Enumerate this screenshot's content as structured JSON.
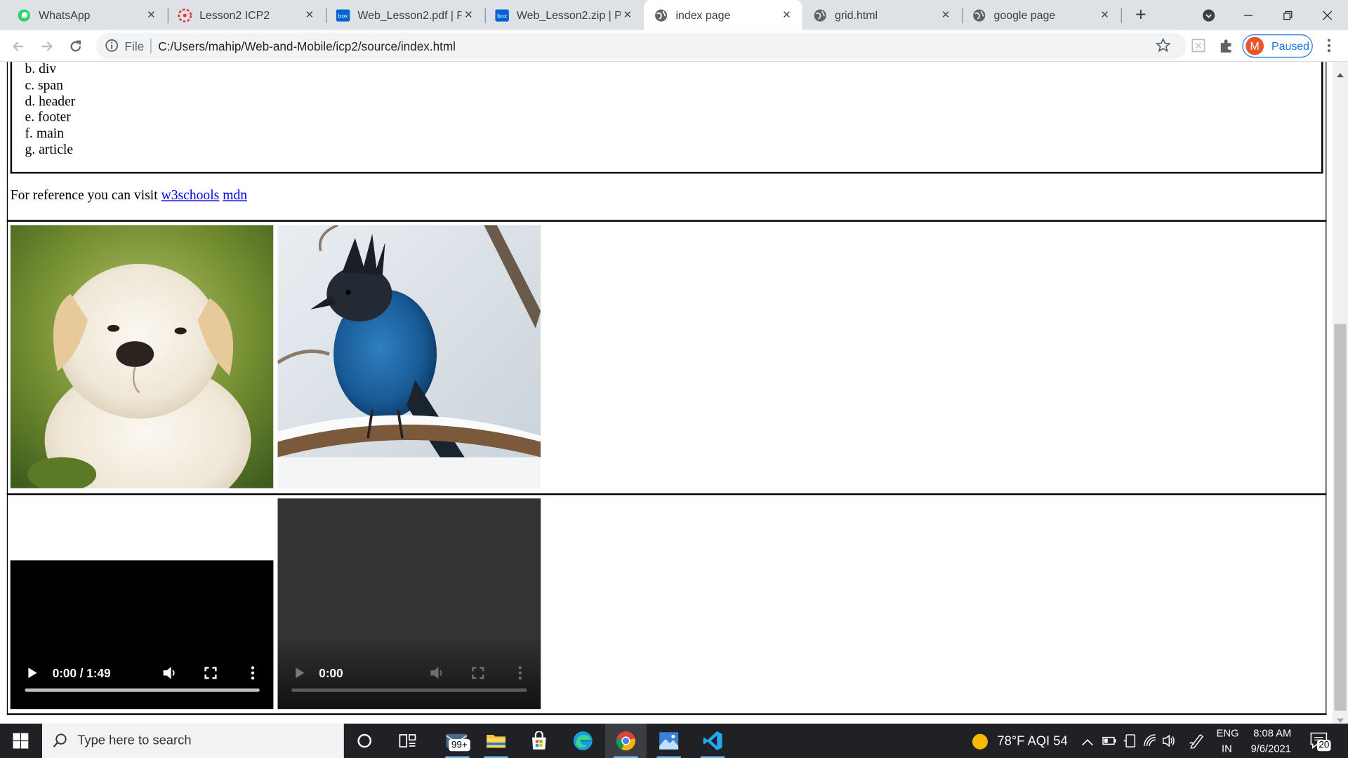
{
  "browser": {
    "tabs": [
      {
        "title": "WhatsApp",
        "icon": "whatsapp-icon",
        "active": false
      },
      {
        "title": "Lesson2 ICP2",
        "icon": "canvas-icon",
        "active": false
      },
      {
        "title": "Web_Lesson2.pdf | Po",
        "icon": "box-icon",
        "active": false
      },
      {
        "title": "Web_Lesson2.zip | Pov",
        "icon": "box-icon",
        "active": false
      },
      {
        "title": "index page",
        "icon": "globe-icon",
        "active": true
      },
      {
        "title": "grid.html",
        "icon": "globe-icon",
        "active": false
      },
      {
        "title": "google page",
        "icon": "globe-icon",
        "active": false
      }
    ],
    "address": {
      "scheme": "File",
      "url": "C:/Users/mahip/Web-and-Mobile/icp2/source/index.html"
    },
    "profile": {
      "initial": "M",
      "status": "Paused"
    }
  },
  "page": {
    "list_items": [
      "b. div",
      "c. span",
      "d. header",
      "e. footer",
      "f. main",
      "g. article"
    ],
    "reference": {
      "prefix": "For reference you can visit",
      "links": [
        "w3schools",
        "mdn"
      ]
    },
    "images": [
      "puppy-photo",
      "blue-jay-photo"
    ],
    "videos": [
      {
        "time": "0:00 / 1:49",
        "state": "enabled"
      },
      {
        "time": "0:00",
        "state": "disabled"
      }
    ]
  },
  "taskbar": {
    "search_placeholder": "Type here to search",
    "mail_badge": "99+",
    "weather": "78°F  AQI 54",
    "lang_top": "ENG",
    "lang_bottom": "IN",
    "time": "8:08 AM",
    "date": "9/6/2021",
    "notifications": "20"
  }
}
